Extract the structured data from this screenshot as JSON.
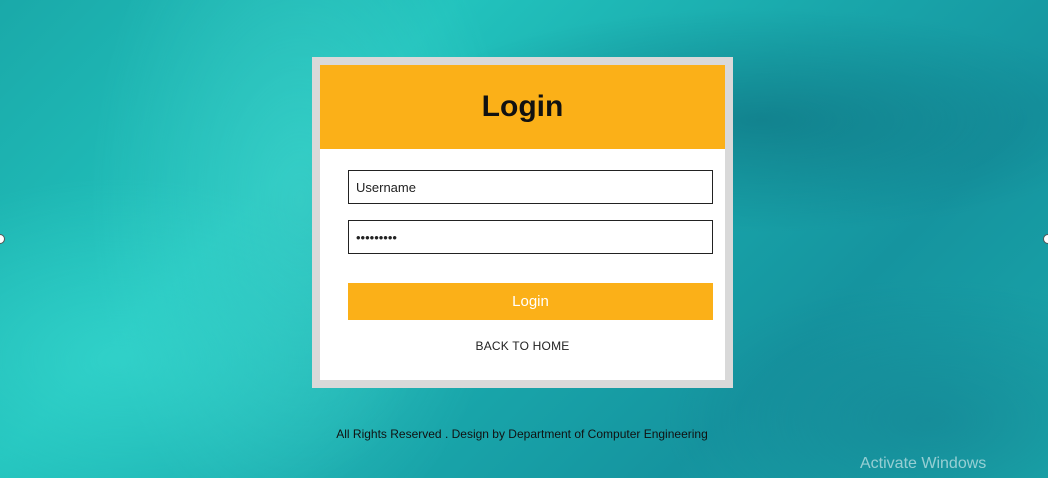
{
  "login_card": {
    "title": "Login",
    "username_placeholder": "Username",
    "password_value": "•••••••••",
    "login_button_label": "Login",
    "back_link_label": "BACK TO HOME"
  },
  "footer": {
    "text": "All Rights Reserved . Design by Department of Computer Engineering"
  },
  "watermark": {
    "text": "Activate Windows"
  },
  "colors": {
    "accent": "#fbb018",
    "background": "#1aa9a9",
    "card": "#ffffff",
    "frame": "#d9d9d9"
  }
}
